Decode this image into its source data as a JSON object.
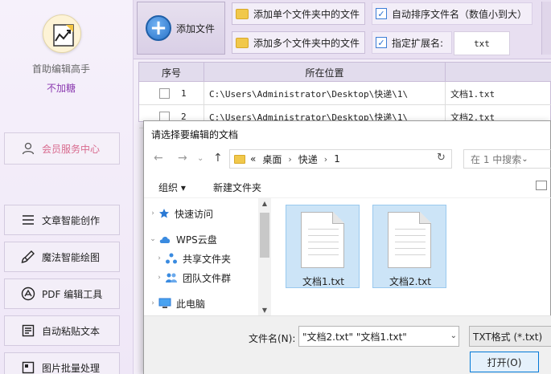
{
  "sidebar": {
    "app_title": "首助编辑高手",
    "app_subtitle": "不加糖",
    "member_center": "会员服务中心",
    "items": [
      {
        "label": "文章智能创作",
        "icon": "lines-icon"
      },
      {
        "label": "魔法智能绘图",
        "icon": "brush-icon"
      },
      {
        "label": "PDF 编辑工具",
        "icon": "pdf-icon"
      },
      {
        "label": "自动粘贴文本",
        "icon": "paste-icon"
      },
      {
        "label": "图片批量处理",
        "icon": "image-icon"
      }
    ]
  },
  "toolbar": {
    "add_file": "添加文件",
    "add_single_folder": "添加单个文件夹中的文件",
    "add_multi_folder": "添加多个文件夹中的文件",
    "auto_sort": "自动排序文件名（数值小到大）",
    "auto_sort_checked": true,
    "specify_ext": "指定扩展名:",
    "specify_ext_checked": true,
    "ext_value": "txt"
  },
  "table": {
    "headers": [
      "序号",
      "所在位置",
      ""
    ],
    "rows": [
      {
        "index": "1",
        "path": "C:\\Users\\Administrator\\Desktop\\快递\\1\\",
        "name": "文档1.txt"
      },
      {
        "index": "2",
        "path": "C:\\Users\\Administrator\\Desktop\\快递\\1\\",
        "name": "文档2.txt"
      }
    ]
  },
  "dialog": {
    "title": "请选择要编辑的文档",
    "breadcrumb_prefix": "«",
    "breadcrumb": [
      "桌面",
      "快递",
      "1"
    ],
    "search_placeholder": "在 1 中搜索",
    "organize": "组织 ▾",
    "new_folder": "新建文件夹",
    "tree": [
      {
        "label": "快速访问",
        "icon": "star-icon",
        "arrow": "›",
        "indent": 0
      },
      {
        "label": "WPS云盘",
        "icon": "cloud-icon",
        "arrow": "⌄",
        "indent": 0
      },
      {
        "label": "共享文件夹",
        "icon": "shared-folder-icon",
        "arrow": "›",
        "indent": 1
      },
      {
        "label": "团队文件群",
        "icon": "team-icon",
        "arrow": "›",
        "indent": 1
      },
      {
        "label": "此电脑",
        "icon": "computer-icon",
        "arrow": "›",
        "indent": 0
      }
    ],
    "files": [
      {
        "name": "文档1.txt",
        "selected": true
      },
      {
        "name": "文档2.txt",
        "selected": true
      }
    ],
    "filename_label": "文件名(N):",
    "filename_value": "\"文档2.txt\" \"文档1.txt\"",
    "filter_value": "TXT格式 (*.txt)",
    "open_button": "打开(O)"
  }
}
